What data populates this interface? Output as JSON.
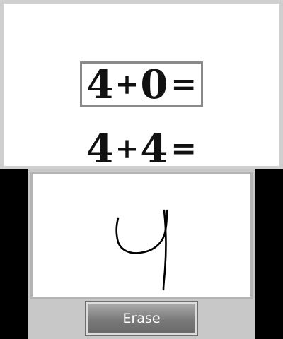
{
  "top_screen": {
    "current_problem": {
      "left": "4",
      "operator": "+",
      "right": "0",
      "equals": "="
    },
    "next_problem": {
      "left": "4",
      "operator": "+",
      "right": "4",
      "equals": "="
    }
  },
  "bottom_screen": {
    "handwritten_answer": "4",
    "erase_label": "Erase"
  },
  "colors": {
    "frame_border": "#8a8a8a",
    "button_gradient_top": "#a8a8a8",
    "button_gradient_bottom": "#6a6a6a",
    "ink": "#000000"
  }
}
